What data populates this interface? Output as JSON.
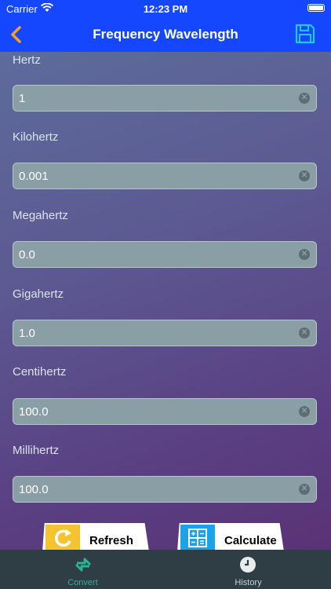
{
  "status_bar": {
    "carrier": "Carrier",
    "time": "12:23 PM"
  },
  "nav": {
    "title": "Frequency Wavelength"
  },
  "fields": [
    {
      "label": "Hertz",
      "value": "1"
    },
    {
      "label": "Kilohertz",
      "value": "0.001"
    },
    {
      "label": "Megahertz",
      "value": "0.0"
    },
    {
      "label": "Gigahertz",
      "value": "1.0"
    },
    {
      "label": "Centihertz",
      "value": "100.0"
    },
    {
      "label": "Millihertz",
      "value": "100.0"
    }
  ],
  "actions": {
    "refresh": "Refresh",
    "calculate": "Calculate"
  },
  "tabs": [
    {
      "label": "Convert",
      "active": true
    },
    {
      "label": "History",
      "active": false
    }
  ],
  "colors": {
    "nav_bg": "#1447ff",
    "tab_active": "#2bb39a",
    "tab_inactive": "#c9d0d4",
    "icon_yellow": "#f4c430",
    "icon_blue": "#1aa3e8"
  }
}
